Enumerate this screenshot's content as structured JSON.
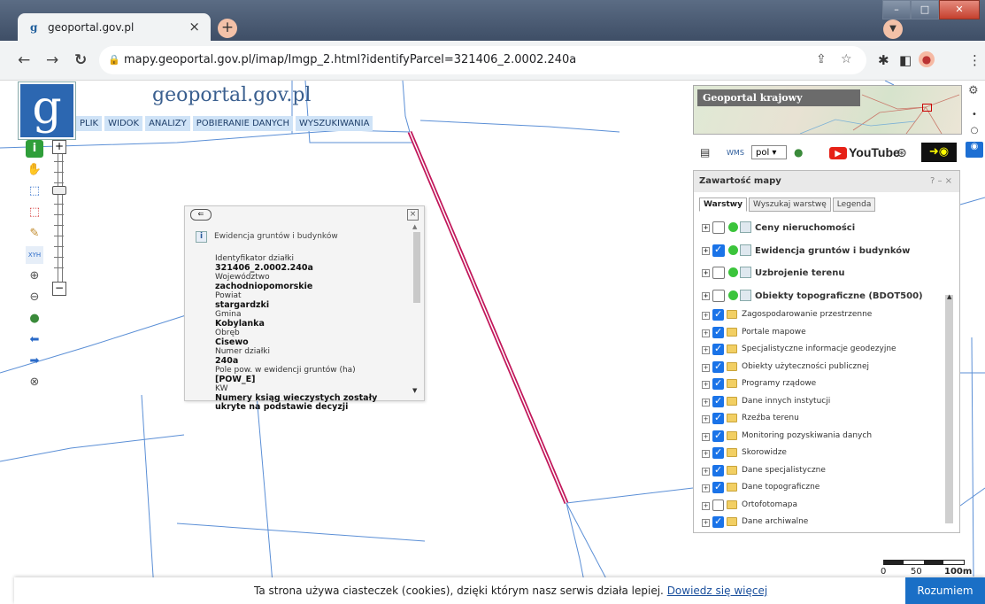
{
  "browser": {
    "tab_title": "geoportal.gov.pl",
    "tab_close": "×",
    "new_tab": "+",
    "url": "mapy.geoportal.gov.pl/imap/Imgp_2.html?identifyParcel=321406_2.0002.240a",
    "window_buttons": [
      "–",
      "□",
      "✕"
    ]
  },
  "app": {
    "logo_letter": "g",
    "brand": "geoportal.gov.pl",
    "menu": [
      "PLIK",
      "WIDOK",
      "ANALIZY",
      "POBIERANIE DANYCH",
      "WYSZUKIWANIA"
    ]
  },
  "identify": {
    "layer": "Ewidencja gruntów i budynków",
    "fields": [
      {
        "label": "Identyfikator działki",
        "value": "321406_2.0002.240a"
      },
      {
        "label": "Województwo",
        "value": "zachodniopomorskie"
      },
      {
        "label": "Powiat",
        "value": "stargardzki"
      },
      {
        "label": "Gmina",
        "value": "Kobylanka"
      },
      {
        "label": "Obręb",
        "value": "Cisewo"
      },
      {
        "label": "Numer działki",
        "value": "240a"
      },
      {
        "label": "Pole pow. w ewidencji gruntów (ha)",
        "value": "[POW_E]"
      },
      {
        "label": "KW",
        "value": "Numery ksiąg wieczystych zostały ukryte na podstawie decyzji"
      }
    ]
  },
  "overview": {
    "title": "Geoportal krajowy"
  },
  "toolbar": {
    "language": "pol",
    "youtube": "YouTube"
  },
  "panel": {
    "title": "Zawartość mapy",
    "controls": "? – ×",
    "tabs": [
      "Warstwy",
      "Wyszukaj warstwę",
      "Legenda"
    ],
    "main_layers": [
      {
        "label": "Ceny nieruchomości",
        "checked": false
      },
      {
        "label": "Ewidencja gruntów i budynków",
        "checked": true
      },
      {
        "label": "Uzbrojenie terenu",
        "checked": false
      },
      {
        "label": "Obiekty topograficzne (BDOT500)",
        "checked": false
      }
    ],
    "groups": [
      {
        "label": "Zagospodarowanie przestrzenne",
        "checked": true
      },
      {
        "label": "Portale mapowe",
        "checked": true
      },
      {
        "label": "Specjalistyczne informacje geodezyjne",
        "checked": true
      },
      {
        "label": "Obiekty użyteczności publicznej",
        "checked": true
      },
      {
        "label": "Programy rządowe",
        "checked": true
      },
      {
        "label": "Dane innych instytucji",
        "checked": true
      },
      {
        "label": "Rzeźba terenu",
        "checked": true
      },
      {
        "label": "Monitoring pozyskiwania danych",
        "checked": true
      },
      {
        "label": "Skorowidze",
        "checked": true
      },
      {
        "label": "Dane specjalistyczne",
        "checked": true
      },
      {
        "label": "Dane topograficzne",
        "checked": true
      },
      {
        "label": "Ortofotomapa",
        "checked": false
      },
      {
        "label": "Dane archiwalne",
        "checked": true
      }
    ]
  },
  "scale": {
    "zero": "0",
    "mid": "50",
    "end": "100m"
  },
  "cookie": {
    "message": "Ta strona używa ciasteczek (cookies), dzięki którym nasz serwis działa lepiej.",
    "link": "Dowiedz się więcej",
    "accept": "Rozumiem"
  },
  "colors": {
    "parcel_highlight": "#c2185b",
    "parcel_lines": "#5b8fd6",
    "accent": "#1a6fc6"
  }
}
